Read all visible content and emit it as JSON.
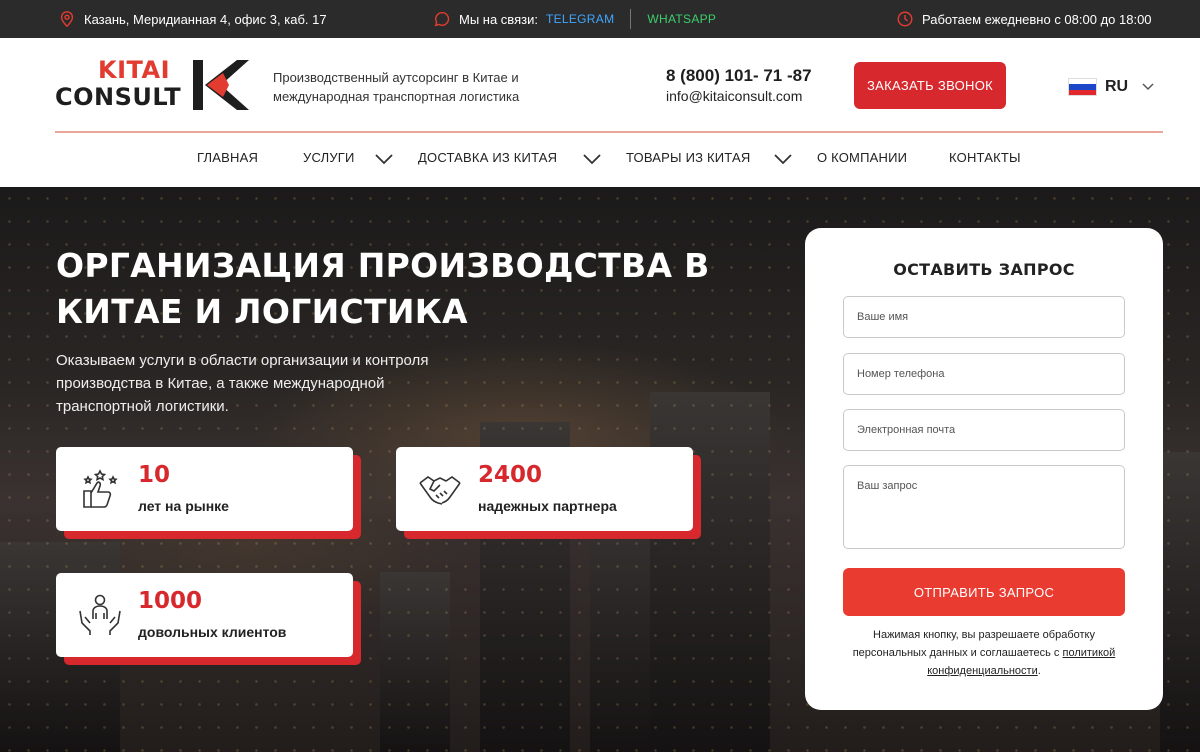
{
  "topbar": {
    "address": "Казань, Меридианная 4, офис 3, каб. 17",
    "contact_label": "Мы на связи:",
    "telegram": "TELEGRAM",
    "whatsapp": "WHATSAPP",
    "hours": "Работаем ежедневно с 08:00 до 18:00"
  },
  "header": {
    "logo_line1": "KITAI",
    "logo_line2": "CONSULT",
    "tagline": "Производственный аутсорсинг в Китае и международная транспортная логистика",
    "phone": "8 (800) 101- 71 -87",
    "email": "info@kitaiconsult.com",
    "call_button": "ЗАКАЗАТЬ ЗВОНОК",
    "language": "RU"
  },
  "nav": {
    "home": "ГЛАВНАЯ",
    "services": "УСЛУГИ",
    "delivery": "ДОСТАВКА ИЗ КИТАЯ",
    "goods": "ТОВАРЫ ИЗ КИТАЯ",
    "about": "О КОМПАНИИ",
    "contacts": "КОНТАКТЫ"
  },
  "hero": {
    "title": "ОРГАНИЗАЦИЯ ПРОИЗВОДСТВА В КИТАЕ И ЛОГИСТИКА",
    "subtitle": "Оказываем услуги в области организации и контроля производства в Китае, а также международной транспортной логистики."
  },
  "stats": [
    {
      "value": "10",
      "label": "лет на рынке",
      "icon": "thumbs-up-stars-icon"
    },
    {
      "value": "2400",
      "label": "надежных партнера",
      "icon": "handshake-icon"
    },
    {
      "value": "1000",
      "label": "довольных клиентов",
      "icon": "happy-client-icon"
    }
  ],
  "form": {
    "title": "ОСТАВИТЬ ЗАПРОС",
    "name_placeholder": "Ваше имя",
    "phone_placeholder": "Номер телефона",
    "email_placeholder": "Электронная почта",
    "request_placeholder": "Ваш запрос",
    "submit": "ОТПРАВИТЬ ЗАПРОС",
    "note_text": "Нажимая кнопку, вы разрешаете обработку персональных данных и соглашаетесь с",
    "note_link": "политикой конфиденциальности",
    "note_end": "."
  },
  "colors": {
    "accent": "#d6282d",
    "button_red": "#ea3b31",
    "topbar_bg": "#2b2b2b",
    "telegram": "#3fa7ff",
    "whatsapp": "#3ccf6b"
  }
}
